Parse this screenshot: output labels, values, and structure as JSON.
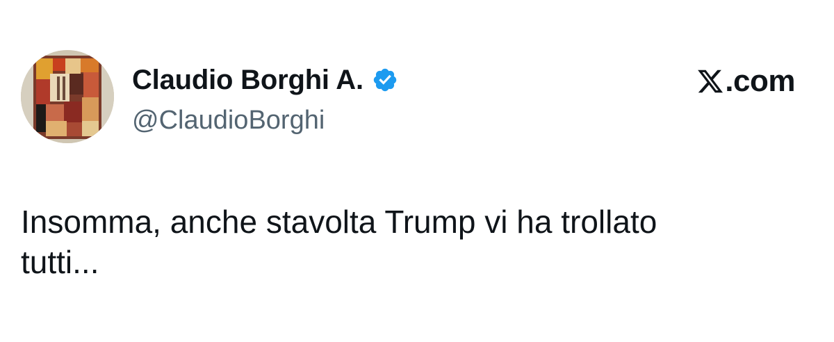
{
  "author": {
    "display_name": "Claudio Borghi A.",
    "handle": "@ClaudioBorghi",
    "verified": true,
    "verified_icon": "verified-badge-icon",
    "verified_color": "#1d9bf0",
    "avatar_icon": "abstract-artwork-avatar"
  },
  "brand": {
    "logo_icon": "x-logo-icon",
    "text": ".com"
  },
  "tweet": {
    "text": "Insomma, anche stavolta Trump vi ha trollato\ntutti..."
  },
  "colors": {
    "text_primary": "#0f1419",
    "text_secondary": "#536471",
    "background": "#ffffff"
  }
}
